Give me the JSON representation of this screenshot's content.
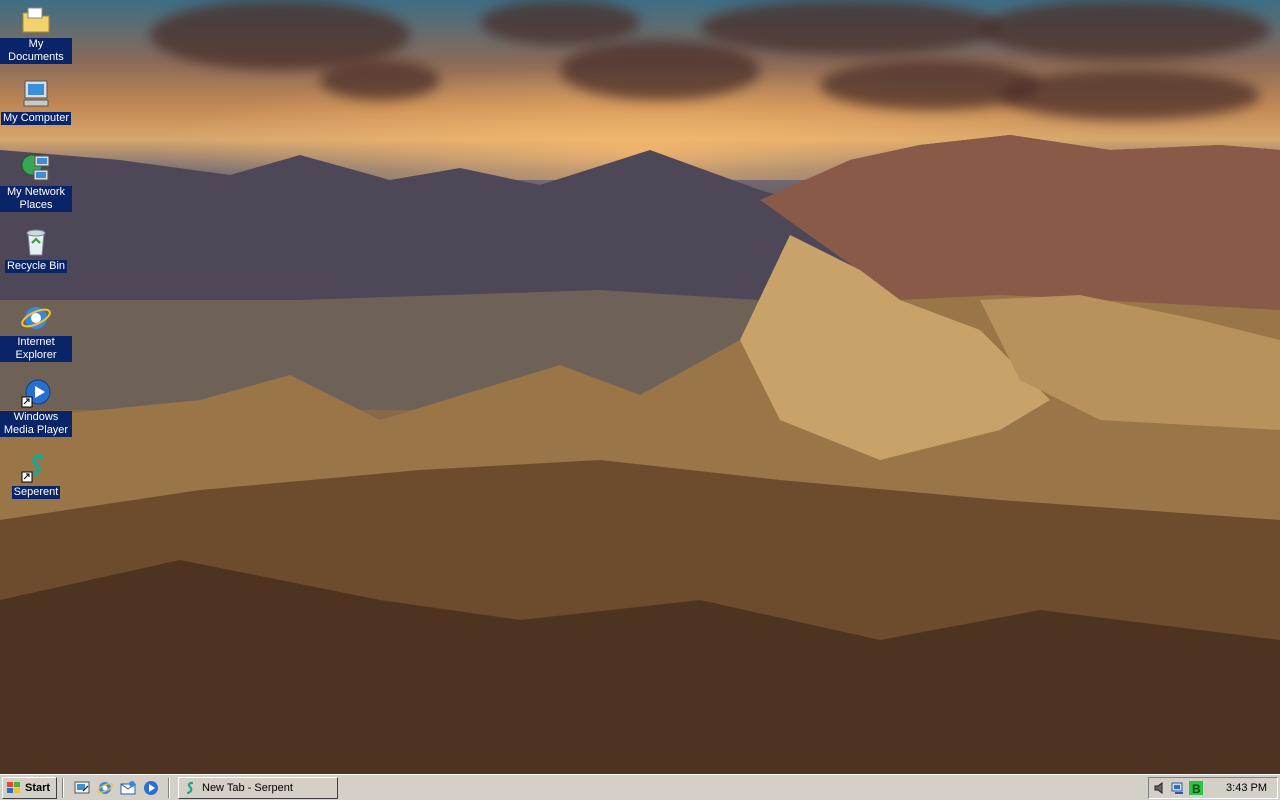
{
  "desktop": {
    "icons": [
      {
        "label": "My Documents",
        "icon": "folder-documents-icon"
      },
      {
        "label": "My Computer",
        "icon": "computer-icon"
      },
      {
        "label": "My Network Places",
        "icon": "network-places-icon"
      },
      {
        "label": "Recycle Bin",
        "icon": "recycle-bin-icon"
      },
      {
        "label": "Internet Explorer",
        "icon": "internet-explorer-icon"
      },
      {
        "label": "Windows Media Player",
        "icon": "media-player-icon"
      },
      {
        "label": "Seperent",
        "icon": "serpent-icon"
      }
    ]
  },
  "taskbar": {
    "start_label": "Start",
    "quick_launch": [
      "show-desktop-icon",
      "internet-explorer-icon",
      "outlook-express-icon",
      "media-player-icon"
    ],
    "task_button_label": "New Tab - Serpent",
    "tray_icons": [
      "volume-icon",
      "network-icon",
      "app-tray-icon"
    ],
    "clock": "3:43 PM"
  },
  "colors": {
    "selection_blue": "#0a246a",
    "taskbar_gray": "#d4d0c8"
  }
}
